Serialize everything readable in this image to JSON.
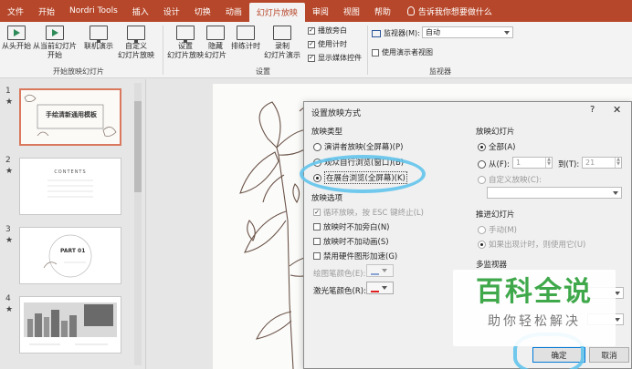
{
  "tabs": [
    "文件",
    "开始",
    "Nordri Tools",
    "插入",
    "设计",
    "切换",
    "动画",
    "幻灯片放映",
    "审阅",
    "视图",
    "帮助"
  ],
  "active_tab_index": 7,
  "tell_me": "告诉我你想要做什么",
  "ribbon": {
    "from_start": "从头开始",
    "from_current_line1": "从当前幻灯片",
    "from_current_line2": "开始",
    "online_line1": "联机演示",
    "custom_line1": "自定义",
    "custom_line2": "幻灯片放映",
    "group_start": "开始放映幻灯片",
    "setup_line1": "设置",
    "setup_line2": "幻灯片放映",
    "hide_line1": "隐藏",
    "hide_line2": "幻灯片",
    "rehearse": "排练计时",
    "record_line1": "录制",
    "record_line2": "幻灯片演示",
    "play_narration": "播放旁白",
    "use_timings": "使用计时",
    "show_media": "显示媒体控件",
    "group_setup": "设置",
    "monitor_label": "监视器(M):",
    "monitor_value": "自动",
    "presenter_view": "使用演示者视图",
    "group_monitor": "监视器"
  },
  "slides": [
    {
      "num": "1",
      "star": "★",
      "title": "手绘清新通用模板"
    },
    {
      "num": "2",
      "star": "★",
      "title": "CONTENTS"
    },
    {
      "num": "3",
      "star": "★",
      "title": "PART 01"
    },
    {
      "num": "4",
      "star": "★",
      "title": ""
    }
  ],
  "dialog": {
    "title": "设置放映方式",
    "help": "?",
    "close": "✕",
    "show_type_label": "放映类型",
    "type_presenter": "演讲者放映(全屏幕)(P)",
    "type_browse_window": "观众自行浏览(窗口)(B)",
    "type_kiosk": "在展台浏览(全屏幕)(K)",
    "options_label": "放映选项",
    "opt_loop": "循环放映，按 ESC 键终止(L)",
    "opt_no_narration": "放映时不加旁白(N)",
    "opt_no_animation": "放映时不加动画(S)",
    "opt_disable_hw": "禁用硬件图形加速(G)",
    "pen_color_label": "绘图笔颜色(E):",
    "laser_color_label": "激光笔颜色(R):",
    "show_slides_label": "放映幻灯片",
    "slides_all": "全部(A)",
    "slides_from": "从(F):",
    "from_value": "1",
    "to_label": "到(T):",
    "to_value": "21",
    "slides_custom": "自定义放映(C):",
    "advance_label": "推进幻灯片",
    "advance_manual": "手动(M)",
    "advance_timing": "如果出现计时，则使用它(U)",
    "multi_monitor_label": "多监视器",
    "ok": "确定",
    "cancel": "取消"
  },
  "colors": {
    "ribbon_red": "#b7472a",
    "highlight": "#62c4ec",
    "laser": "#e02020",
    "pen": "#4472c4"
  },
  "watermark": {
    "main": "百科全说",
    "sub": "助你轻松解决"
  }
}
